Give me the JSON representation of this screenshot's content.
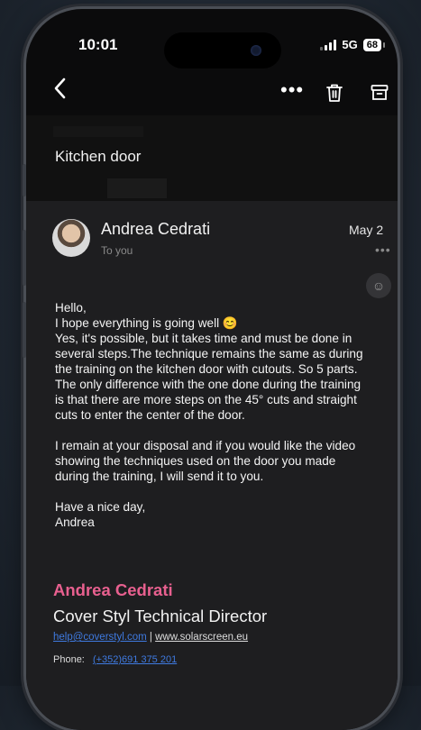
{
  "status_bar": {
    "time": "10:01",
    "network": "5G",
    "battery": "68"
  },
  "toolbar": {
    "back_icon": "chevron-left-icon",
    "more_label": "•••",
    "trash_icon": "trash-icon",
    "archive_icon": "archive-icon"
  },
  "email": {
    "subject": "Kitchen door",
    "sender": "Andrea Cedrati",
    "recipient": "To you",
    "date": "May 2",
    "header_more": "•••",
    "react_icon": "emoji-icon",
    "body": "Hello,\nI hope everything is going well 😊\nYes, it's possible, but it takes time and must be done in several steps.The technique remains the same as during the training on the kitchen door with cutouts. So 5 parts.\nThe only difference with the one done during the training is that there are more steps on the 45° cuts and straight cuts to enter the center of the door.\n\nI remain at your disposal and if you would like the video showing the techniques used on the door you made during the training, I will send it to you.\n\nHave a nice day,\nAndrea",
    "signature": {
      "name": "Andrea Cedrati",
      "title": "Cover Styl Technical Director",
      "email_link": "help@coverstyl.com",
      "separator": "|",
      "website_link": "www.solarscreen.eu",
      "phone_label": "Phone:",
      "phone_number": "(+352)691 375 201"
    }
  },
  "colors": {
    "signature_name": "#e8608f",
    "link": "#3f7ae0",
    "card_background": "#1e1e20"
  }
}
